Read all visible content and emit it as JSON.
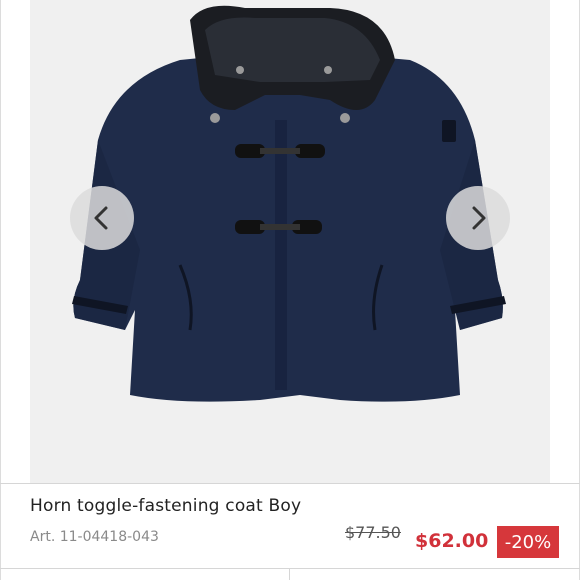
{
  "product": {
    "title": "Horn toggle-fastening coat Boy",
    "article": "Art. 11-04418-043",
    "old_price": "$77.50",
    "new_price": "$62.00",
    "discount": "-20%"
  },
  "gallery": {
    "image_subject": "navy-hooded-toggle-coat",
    "prev_icon": "chevron-left-icon",
    "next_icon": "chevron-right-icon"
  },
  "colors": {
    "sale_red": "#d1313a",
    "badge_bg": "#d6373b",
    "coat_navy": "#1f2c4a",
    "hood_black": "#1b1d22",
    "image_bg": "#f0f0f0"
  }
}
